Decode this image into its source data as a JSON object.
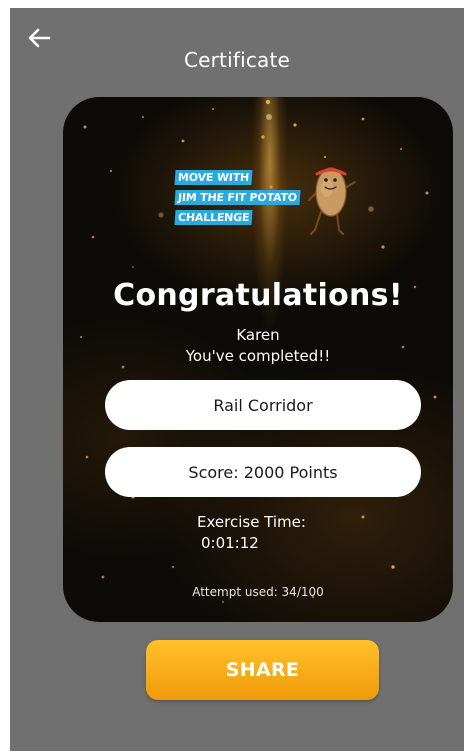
{
  "header": {
    "title": "Certificate",
    "back_icon": "arrow-left-icon"
  },
  "certificate": {
    "logo": {
      "line1": "MOVE WITH",
      "line2": "JIM THE FIT POTATO",
      "line3": "CHALLENGE",
      "mascot_icon": "potato-mascot-icon"
    },
    "heading": "Congratulations!",
    "user_name": "Karen",
    "completed_text": "You've completed!!",
    "route_name": "Rail Corridor",
    "score_text": "Score: 2000 Points",
    "exercise_time_label": "Exercise Time:",
    "exercise_time_value": "0:01:12",
    "attempts_text": "Attempt used: 34/100"
  },
  "actions": {
    "share_label": "SHARE"
  },
  "colors": {
    "background": "#707070",
    "card": "#0d0b08",
    "logo_blue": "#2aa9df",
    "share_button": "#f5a711",
    "text_white": "#ffffff"
  }
}
